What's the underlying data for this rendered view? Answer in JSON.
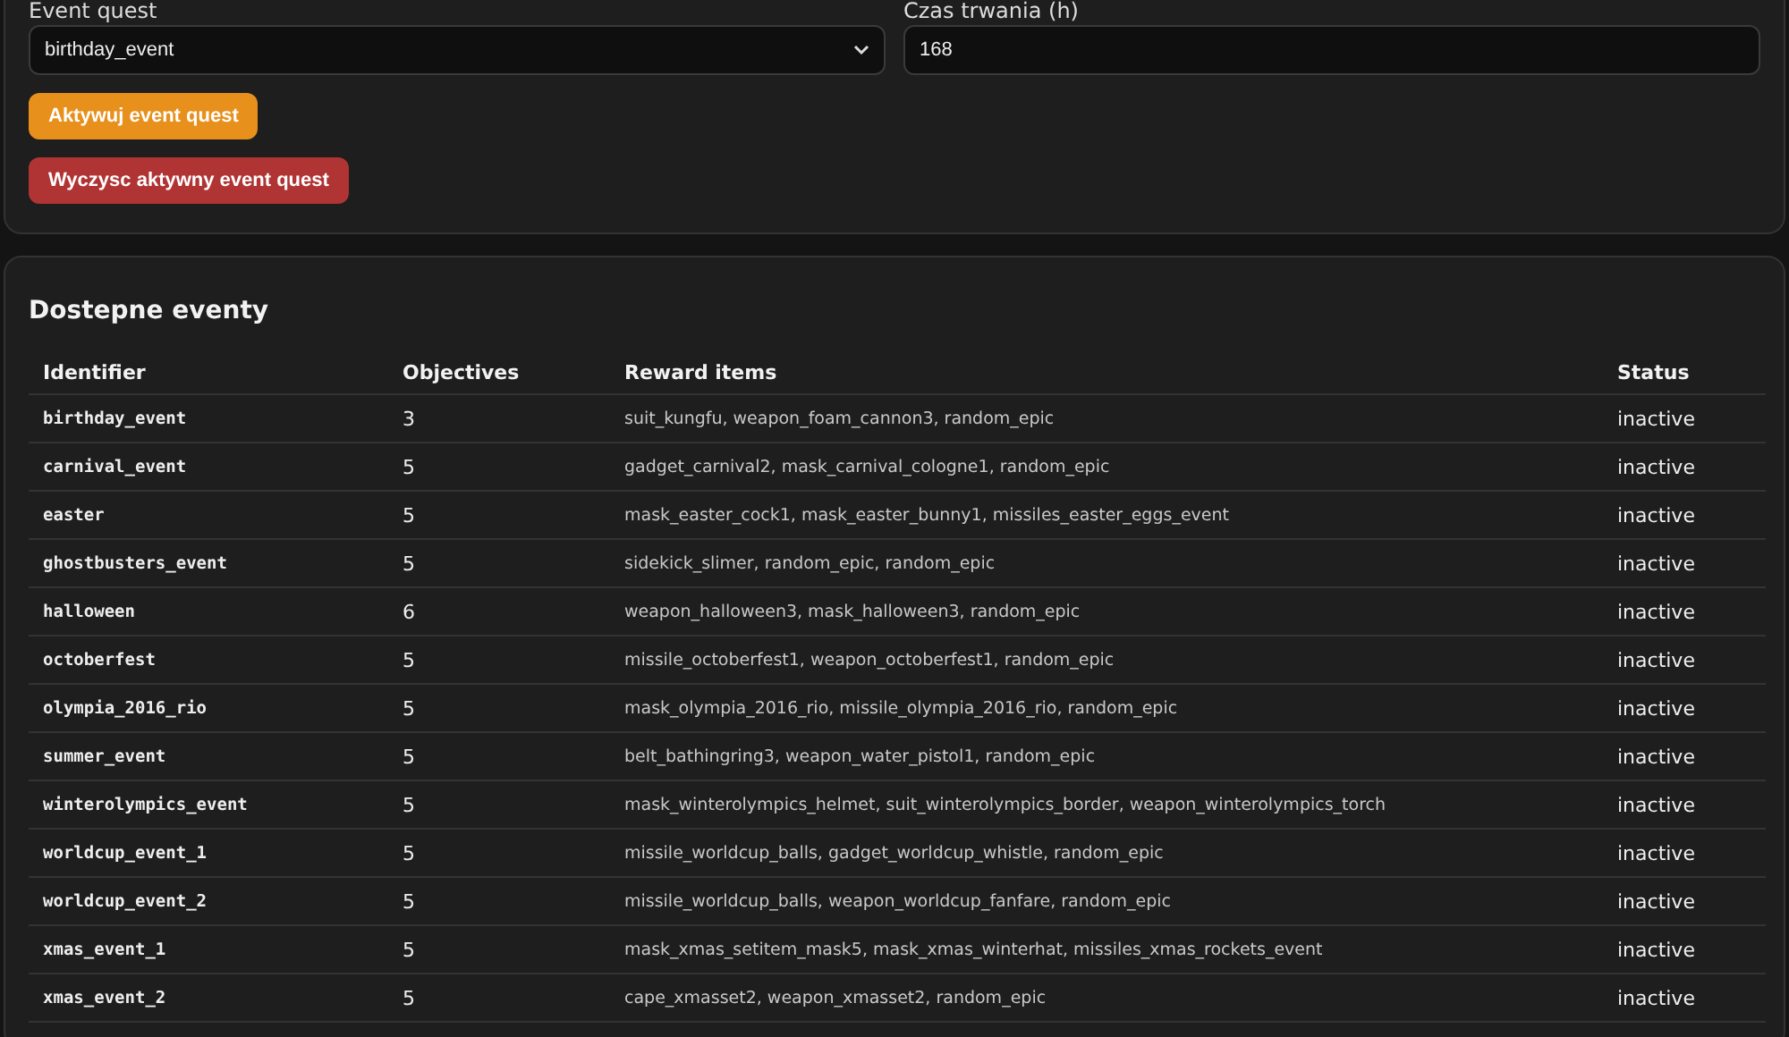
{
  "quest_form": {
    "event_label": "Event quest",
    "event_value": "birthday_event",
    "duration_label": "Czas trwania (h)",
    "duration_value": "168",
    "activate_button": "Aktywuj event quest",
    "clear_button": "Wyczysc aktywny event quest"
  },
  "events": {
    "title": "Dostepne eventy",
    "columns": [
      "Identifier",
      "Objectives",
      "Reward items",
      "Status"
    ],
    "rows": [
      {
        "identifier": "birthday_event",
        "objectives": "3",
        "rewards": "suit_kungfu, weapon_foam_cannon3, random_epic",
        "status": "inactive"
      },
      {
        "identifier": "carnival_event",
        "objectives": "5",
        "rewards": "gadget_carnival2, mask_carnival_cologne1, random_epic",
        "status": "inactive"
      },
      {
        "identifier": "easter",
        "objectives": "5",
        "rewards": "mask_easter_cock1, mask_easter_bunny1, missiles_easter_eggs_event",
        "status": "inactive"
      },
      {
        "identifier": "ghostbusters_event",
        "objectives": "5",
        "rewards": "sidekick_slimer, random_epic, random_epic",
        "status": "inactive"
      },
      {
        "identifier": "halloween",
        "objectives": "6",
        "rewards": "weapon_halloween3, mask_halloween3, random_epic",
        "status": "inactive"
      },
      {
        "identifier": "octoberfest",
        "objectives": "5",
        "rewards": "missile_octoberfest1, weapon_octoberfest1, random_epic",
        "status": "inactive"
      },
      {
        "identifier": "olympia_2016_rio",
        "objectives": "5",
        "rewards": "mask_olympia_2016_rio, missile_olympia_2016_rio, random_epic",
        "status": "inactive"
      },
      {
        "identifier": "summer_event",
        "objectives": "5",
        "rewards": "belt_bathingring3, weapon_water_pistol1, random_epic",
        "status": "inactive"
      },
      {
        "identifier": "winterolympics_event",
        "objectives": "5",
        "rewards": "mask_winterolympics_helmet, suit_winterolympics_border, weapon_winterolympics_torch",
        "status": "inactive"
      },
      {
        "identifier": "worldcup_event_1",
        "objectives": "5",
        "rewards": "missile_worldcup_balls, gadget_worldcup_whistle, random_epic",
        "status": "inactive"
      },
      {
        "identifier": "worldcup_event_2",
        "objectives": "5",
        "rewards": "missile_worldcup_balls, weapon_worldcup_fanfare, random_epic",
        "status": "inactive"
      },
      {
        "identifier": "xmas_event_1",
        "objectives": "5",
        "rewards": "mask_xmas_setitem_mask5, mask_xmas_winterhat, missiles_xmas_rockets_event",
        "status": "inactive"
      },
      {
        "identifier": "xmas_event_2",
        "objectives": "5",
        "rewards": "cape_xmasset2, weapon_xmasset2, random_epic",
        "status": "inactive"
      }
    ]
  }
}
